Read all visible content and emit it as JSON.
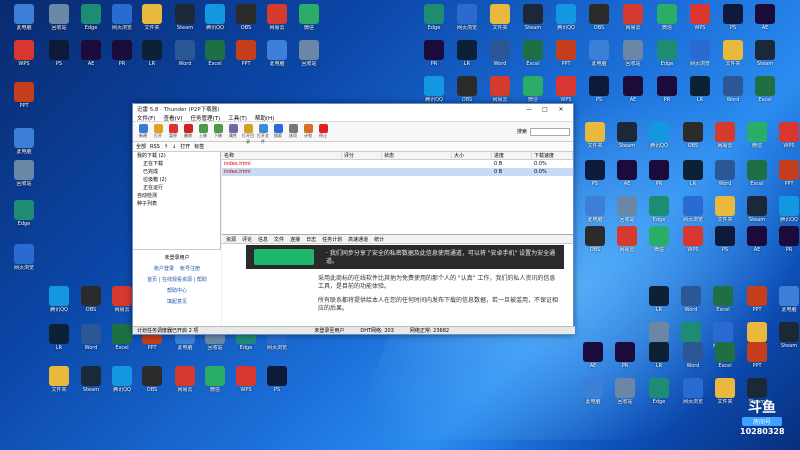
{
  "window": {
    "title": "迅雷 5.8 · Thunder (P2P下载器)",
    "controls": [
      "—",
      "□",
      "✕"
    ]
  },
  "menu": [
    "文件(F)",
    "查看(V)",
    "任务管理(T)",
    "工具(T)",
    "帮助(H)"
  ],
  "toolbar": [
    "新建",
    "打开",
    "暂停",
    "删除",
    "上移",
    "下移",
    "属性",
    "打开目录",
    "打开文件",
    "搜索",
    "选项",
    "计划",
    "停止"
  ],
  "toolbar_search": {
    "label": "搜索",
    "value": ""
  },
  "subbar": [
    "全部",
    "RSS",
    "↑",
    "↓",
    "打开",
    "标签"
  ],
  "tree": [
    "我的下载 (2)",
    "正在下载",
    "已完成",
    "垃圾箱 (2)",
    "正在运行",
    "自动检测",
    "种子列表"
  ],
  "promo": {
    "title": "未登录用户",
    "row": [
      "账户登录",
      "帐号注册"
    ],
    "links": [
      "首页 | 在线观看资源 | 帮助",
      "帮助中心",
      "填起意见"
    ]
  },
  "table": {
    "headers": [
      "名称",
      "评分",
      "状态",
      "大小",
      "进度",
      "下载速度"
    ],
    "rows": [
      [
        "index.html",
        "",
        "",
        "0 B",
        "0.0%",
        ""
      ],
      [
        "index.html",
        "",
        "",
        "0 B",
        "0.0%",
        ""
      ]
    ]
  },
  "tabs": [
    "资源",
    "评论",
    "信息",
    "文件",
    "连接",
    "日志",
    "任务计划",
    "高速通道",
    "统计"
  ],
  "content_lines": [
    "· 我们同步分享了安全的私密数据及此信息使用通道，可以将 \"安卓手机\" 设置为安全通道。",
    "采用此商标的在线软件比其他为免费使用的那个人的 \"认真\" 工作，我们的私人资讯的信息工具，是目前的功能体验。",
    "所有联系都将提供给本人在您的任何时间内发布下载的信息数据，若一旦被滥用，不保证相应的后果。"
  ],
  "status": [
    "计划任务调度器已开启 2 项",
    "未登录至用户",
    "DHT网络: 203",
    "网络正常: 23682"
  ],
  "logo": {
    "main": "斗鱼",
    "sub": "房间号",
    "room": "10280328"
  },
  "icons": [
    {
      "label": "此电脑",
      "color": "#3b7fd9"
    },
    {
      "label": "回收站",
      "color": "#6b87a8"
    },
    {
      "label": "Edge",
      "color": "#1e8c73"
    },
    {
      "label": "网页浏览",
      "color": "#2a6bd1"
    },
    {
      "label": "文件夹",
      "color": "#e8b93c"
    },
    {
      "label": "Steam",
      "color": "#1b2838"
    },
    {
      "label": "腾讯QQ",
      "color": "#1297e0"
    },
    {
      "label": "OBS",
      "color": "#2b2b2b"
    },
    {
      "label": "网易云",
      "color": "#d53a2e"
    },
    {
      "label": "微信",
      "color": "#2aae67"
    },
    {
      "label": "WPS",
      "color": "#d8362f"
    },
    {
      "label": "PS",
      "color": "#0d1a3a"
    },
    {
      "label": "AE",
      "color": "#1a0b3a"
    },
    {
      "label": "PR",
      "color": "#1a0b3a"
    },
    {
      "label": "LR",
      "color": "#0c2036"
    },
    {
      "label": "Word",
      "color": "#2b5797"
    },
    {
      "label": "Excel",
      "color": "#1e7044"
    },
    {
      "label": "PPT",
      "color": "#c43e1c"
    }
  ]
}
